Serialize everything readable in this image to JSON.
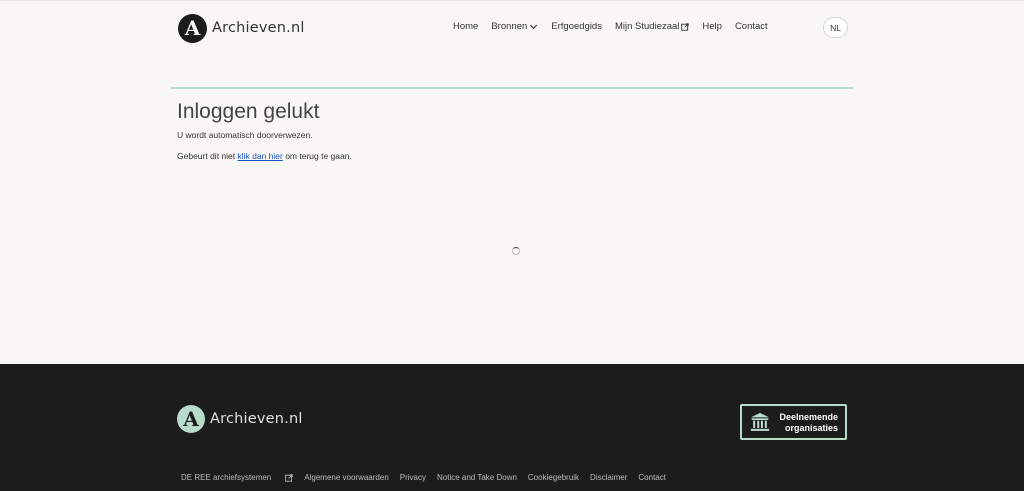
{
  "header": {
    "logo_letter": "A",
    "logo_text": "Archieven.nl",
    "nav": [
      {
        "label": "Home"
      },
      {
        "label": "Bronnen"
      },
      {
        "label": "Erfgoedgids"
      },
      {
        "label": "Mijn Studiezaal"
      },
      {
        "label": "Help"
      },
      {
        "label": "Contact"
      }
    ],
    "language": "NL"
  },
  "main": {
    "title": "Inloggen gelukt",
    "message": "U wordt automatisch doorverwezen.",
    "fallback_prefix": "Gebeurt dit niet ",
    "fallback_link": "klik dan hier",
    "fallback_suffix": " om terug te gaan."
  },
  "footer": {
    "logo_letter": "A",
    "logo_text": "Archieven.nl",
    "orgs_button": {
      "line1": "Deelnemende",
      "line2": "organisaties"
    },
    "links": [
      {
        "label": "DE REE archiefsystemen"
      },
      {
        "label": "Algemene voorwaarden"
      },
      {
        "label": "Privacy"
      },
      {
        "label": "Notice and Take Down"
      },
      {
        "label": "Cookiegebruik"
      },
      {
        "label": "Disclaimer"
      },
      {
        "label": "Contact"
      }
    ]
  },
  "colors": {
    "accent": "#b8dcc9",
    "link": "#1a56c4",
    "footer_bg": "#1c1c1c",
    "page_bg": "#f8f7f5"
  },
  "icons": {
    "external": "external-link-icon",
    "chevron": "chevron-down-icon",
    "institution": "museum-icon",
    "spinner": "loading-spinner-icon"
  }
}
